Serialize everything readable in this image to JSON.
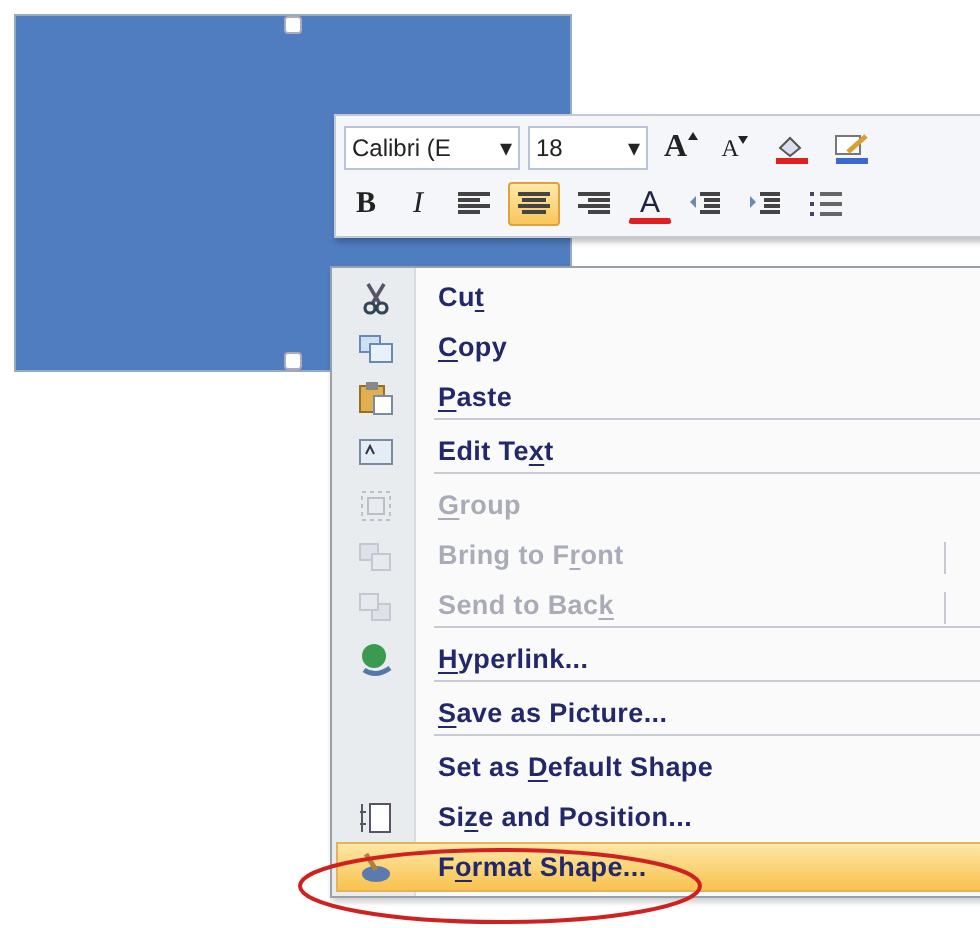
{
  "shape": {
    "selected": true
  },
  "mini_toolbar": {
    "font": "Calibri (E",
    "font_size": "18",
    "dropdown": "▾",
    "row1": [
      {
        "kind": "grow",
        "label": "A"
      },
      {
        "kind": "shrink",
        "label": "A"
      },
      {
        "kind": "fill"
      },
      {
        "kind": "line"
      }
    ],
    "row2": [
      {
        "kind": "bold",
        "label": "B",
        "selected": false
      },
      {
        "kind": "italic",
        "label": "I",
        "selected": false
      },
      {
        "kind": "align-left",
        "selected": false
      },
      {
        "kind": "align-center",
        "selected": true
      },
      {
        "kind": "align-right",
        "selected": false
      },
      {
        "kind": "font-color",
        "label": "A",
        "selected": false
      },
      {
        "kind": "outdent",
        "selected": false
      },
      {
        "kind": "indent",
        "selected": false
      },
      {
        "kind": "bullets",
        "selected": false
      }
    ]
  },
  "context_menu": [
    {
      "pre": "Cu",
      "key": "t",
      "disabled": false,
      "selected": false,
      "split": false,
      "separator_after": false
    },
    {
      "key": "C",
      "post": "opy",
      "disabled": false,
      "selected": false,
      "split": false,
      "separator_after": false
    },
    {
      "key": "P",
      "post": "aste",
      "disabled": false,
      "selected": false,
      "split": false,
      "separator_after": true
    },
    {
      "pre": "Edit Te",
      "key": "x",
      "post": "t",
      "disabled": false,
      "selected": false,
      "split": false,
      "separator_after": true
    },
    {
      "key": "G",
      "post": "roup",
      "disabled": true,
      "selected": false,
      "split": false,
      "separator_after": false
    },
    {
      "pre": "Bring to F",
      "key": "r",
      "post": "ont",
      "disabled": true,
      "selected": false,
      "split": true,
      "separator_after": false
    },
    {
      "pre": "Send to Bac",
      "key": "k",
      "disabled": true,
      "selected": false,
      "split": true,
      "separator_after": true
    },
    {
      "key": "H",
      "post": "yperlink...",
      "disabled": false,
      "selected": false,
      "split": false,
      "separator_after": true
    },
    {
      "key": "S",
      "post": "ave as Picture...",
      "disabled": false,
      "selected": false,
      "split": false,
      "separator_after": true
    },
    {
      "pre": "Set as ",
      "key": "D",
      "post": "efault Shape",
      "disabled": false,
      "selected": false,
      "split": false,
      "separator_after": false
    },
    {
      "pre": "Si",
      "key": "z",
      "post": "e and Position...",
      "disabled": false,
      "selected": false,
      "split": false,
      "separator_after": false
    },
    {
      "pre": "F",
      "key": "o",
      "post": "rmat Shape...",
      "disabled": false,
      "selected": true,
      "split": false,
      "separator_after": false
    }
  ],
  "annotation": {
    "kind": "ellipse"
  }
}
